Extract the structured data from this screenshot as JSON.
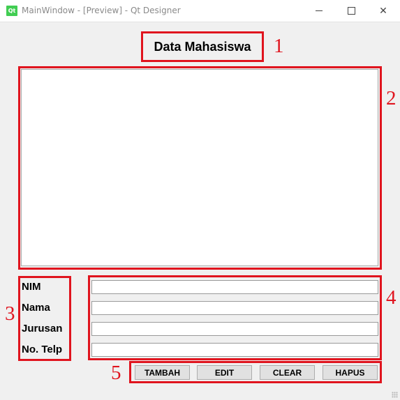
{
  "window": {
    "app_icon": "qt-icon",
    "app_icon_text": "Qt",
    "title": "MainWindow - [Preview] - Qt Designer",
    "minimize_glyph": "—",
    "maximize_glyph": "☐",
    "close_glyph": "✕"
  },
  "page": {
    "title": "Data Mahasiswa"
  },
  "form": {
    "fields": [
      {
        "label": "NIM",
        "value": ""
      },
      {
        "label": "Nama",
        "value": ""
      },
      {
        "label": "Jurusan",
        "value": ""
      },
      {
        "label": "No. Telp",
        "value": ""
      }
    ]
  },
  "buttons": {
    "tambah": "TAMBAH",
    "edit": "EDIT",
    "clear": "CLEAR",
    "hapus": "HAPUS"
  },
  "annotations": {
    "n1": "1",
    "n2": "2",
    "n3": "3",
    "n4": "4",
    "n5": "5",
    "color": "#e0141e"
  }
}
